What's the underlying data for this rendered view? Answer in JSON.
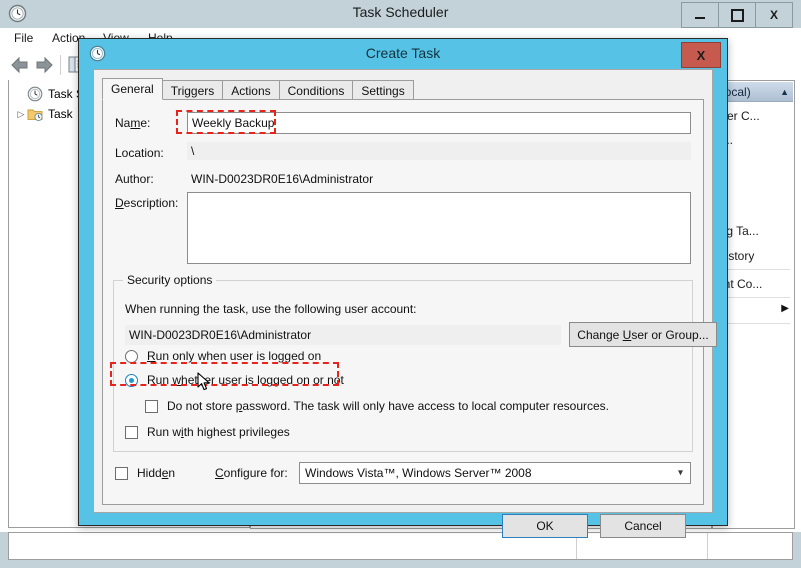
{
  "background_window": {
    "title": "Task Scheduler",
    "app_icon": "clock-icon",
    "window_buttons": {
      "minimize": "—",
      "maximize": "□",
      "close": "X"
    },
    "menu": [
      "File",
      "Action",
      "View",
      "Help"
    ],
    "toolbar_icons": [
      "back-arrow-icon",
      "forward-arrow-icon",
      "show-hide-pane-icon"
    ],
    "tree": [
      {
        "label": "Task Sch",
        "icon": "clock-icon",
        "expandable": false
      },
      {
        "label": "Task",
        "icon": "folder-task-icon",
        "expandable": true
      }
    ],
    "actions_pane": {
      "header": "Local)",
      "collapse_icon": "chevron-up-icon",
      "items": [
        "ther C...",
        "k...",
        "ing Ta...",
        "History",
        "unt Co..."
      ],
      "overflow_icon": "play-arrow-icon"
    }
  },
  "dialog": {
    "title": "Create Task",
    "icon": "clock-icon",
    "close_label": "X",
    "tabs": [
      {
        "label": "General",
        "active": true
      },
      {
        "label": "Triggers",
        "active": false
      },
      {
        "label": "Actions",
        "active": false
      },
      {
        "label": "Conditions",
        "active": false
      },
      {
        "label": "Settings",
        "active": false
      }
    ],
    "fields": {
      "name_label": "Name:",
      "name_value": "Weekly Backup",
      "location_label": "Location:",
      "location_value": "\\",
      "author_label": "Author:",
      "author_value": "WIN-D0023DR0E16\\Administrator",
      "description_label": "Description:",
      "description_value": ""
    },
    "security": {
      "group_title": "Security options",
      "account_prompt": "When running the task, use the following user account:",
      "account_value": "WIN-D0023DR0E16\\Administrator",
      "change_user_button": "Change User or Group...",
      "radio_logged_on": "Run only when user is logged on",
      "radio_logged_on_or_not": "Run whether user is logged on or not",
      "selected_radio": "radio_logged_on_or_not",
      "checkbox_no_password": "Do not store password.  The task will only have access to local computer resources.",
      "checkbox_no_password_checked": false,
      "checkbox_highest_privileges": "Run with highest privileges",
      "checkbox_highest_privileges_checked": false
    },
    "footer": {
      "hidden_label": "Hidden",
      "hidden_checked": false,
      "configure_for_label": "Configure for:",
      "configure_for_value": "Windows Vista™, Windows Server™ 2008",
      "configure_for_arrow": "chevron-down-icon"
    },
    "buttons": {
      "ok": "OK",
      "cancel": "Cancel"
    }
  },
  "annotations": {
    "highlight_color": "#e8231b",
    "highlights": [
      "name-field-highlight",
      "run-whether-logged-on-highlight"
    ]
  },
  "accent_colors": {
    "dialog_titlebar": "#56c2e6",
    "close_button": "#c75a4f",
    "window_chrome": "#c3d2d8",
    "actions_header": "#aebfd2"
  }
}
